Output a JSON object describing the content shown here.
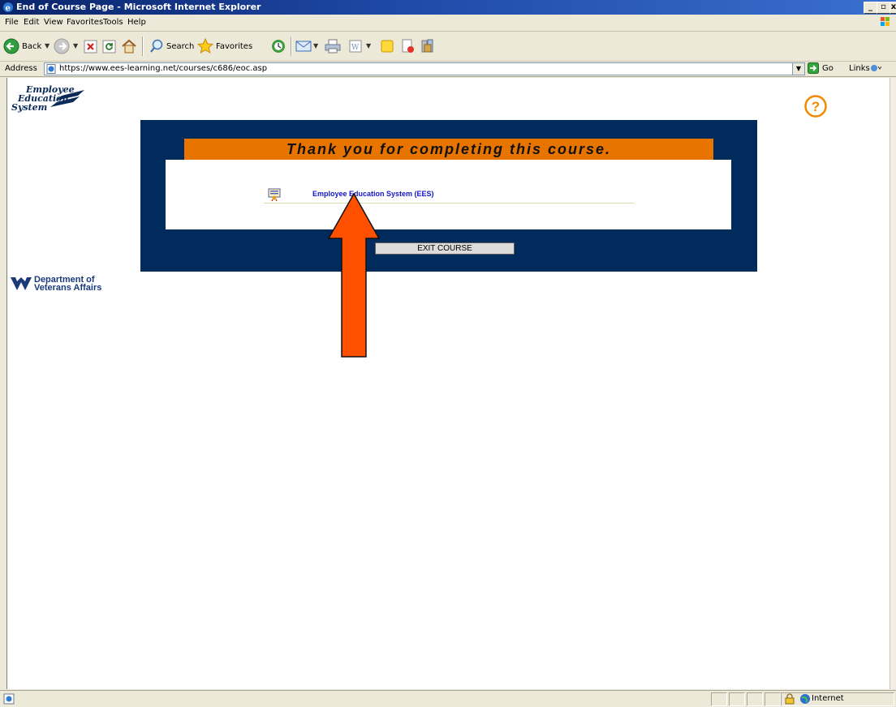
{
  "window": {
    "title": "End of Course Page - Microsoft Internet Explorer",
    "buttons": [
      "_",
      "▫",
      "x"
    ]
  },
  "menu": {
    "items": [
      "File",
      "Edit",
      "View",
      "Favorites",
      "Tools",
      "Help"
    ]
  },
  "toolbar": {
    "back_label": "Back",
    "search_label": "Search",
    "favorites_label": "Favorites"
  },
  "address": {
    "label": "Address",
    "url": "https://www.ees-learning.net/courses/c686/eoc.asp",
    "go_label": "Go",
    "links_label": "Links"
  },
  "page": {
    "logo_lines": [
      "Employee",
      "Education",
      "System"
    ],
    "va_lines": [
      "Department of",
      "Veterans Affairs"
    ],
    "banner_text": "Thank you for completing this course.",
    "course_link": "Employee Education System (EES)",
    "exit_button": "EXIT COURSE",
    "help_glyph": "?"
  },
  "status": {
    "zone": "Internet"
  },
  "colors": {
    "panel": "#002b5c",
    "banner": "#e87400",
    "arrow": "#ff5000",
    "link": "#1515c8"
  }
}
